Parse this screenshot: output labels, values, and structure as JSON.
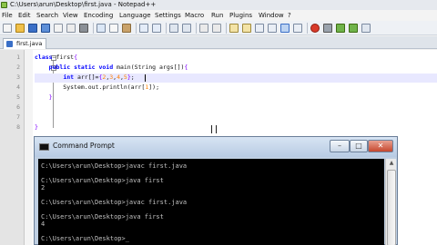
{
  "window": {
    "title": "C:\\Users\\arun\\Desktop\\first.java - Notepad++"
  },
  "menu": [
    "File",
    "Edit",
    "Search",
    "View",
    "Encoding",
    "Language",
    "Settings",
    "Macro",
    "Run",
    "Plugins",
    "Window",
    "?"
  ],
  "tabs": [
    {
      "label": "first.java"
    }
  ],
  "editor": {
    "line_numbers": [
      "1",
      "2",
      "3",
      "4",
      "5",
      "6",
      "7",
      "8"
    ],
    "lines": [
      "class first{",
      "    public static void main(String args[]){",
      "        int arr[]={2,3,4,5};",
      "        System.out.println(arr[1]);",
      "    }",
      "",
      "",
      "}"
    ]
  },
  "cmd": {
    "title": "Command Prompt",
    "buttons": {
      "minimize": "–",
      "maximize": "□",
      "close": "✕"
    },
    "lines": [
      "C:\\Users\\arun\\Desktop>javac first.java",
      "",
      "C:\\Users\\arun\\Desktop>java first",
      "2",
      "",
      "C:\\Users\\arun\\Desktop>javac first.java",
      "",
      "C:\\Users\\arun\\Desktop>java first",
      "4",
      "",
      "C:\\Users\\arun\\Desktop>_"
    ]
  },
  "icons": {
    "app": "notepad-plus-plus-icon",
    "tab": "saved-disk-icon",
    "console": "console-icon"
  },
  "colors": {
    "keyword": "#0000ff",
    "number": "#ff8000",
    "brace": "#8000ff",
    "console_bg": "#000000",
    "console_text": "#c0c0c0"
  }
}
